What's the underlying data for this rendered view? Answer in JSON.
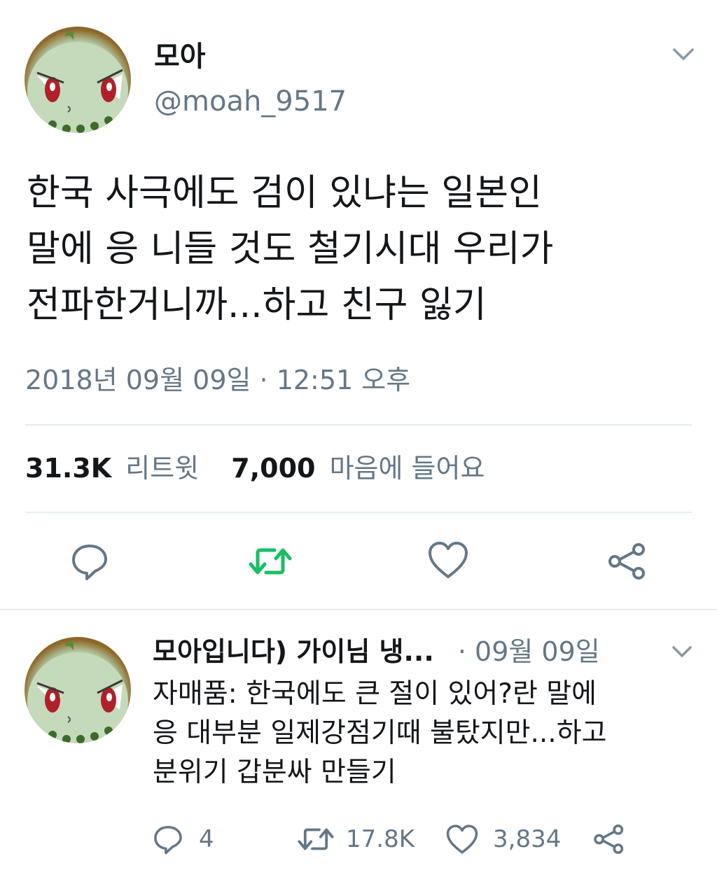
{
  "tweet": {
    "display_name": "모아",
    "handle": "@moah_9517",
    "text_lines": [
      "한국 사극에도 검이 있냐는 일본인",
      "말에 응 니들 것도 철기시대 우리가",
      "전파한거니까...하고 친구 잃기"
    ],
    "timestamp": "2018년 09월 09일 · 12:51 오후",
    "retweet_count": "31.3K",
    "retweet_label": "리트윗",
    "like_count": "7,000",
    "like_label": "마음에 들어요",
    "colors": {
      "retweet_active": "#17bf63",
      "icon_gray": "#657786"
    }
  },
  "reply": {
    "display_name": "모아입니다) 가이님 냉...",
    "date": "· 09월 09일",
    "text_lines": [
      "자매품: 한국에도 큰 절이 있어?란 말에",
      "응 대부분 일제강점기때 불탔지만...하고",
      "분위기 갑분싸 만들기"
    ],
    "reply_count": "4",
    "retweet_count": "17.8K",
    "like_count": "3,834"
  }
}
